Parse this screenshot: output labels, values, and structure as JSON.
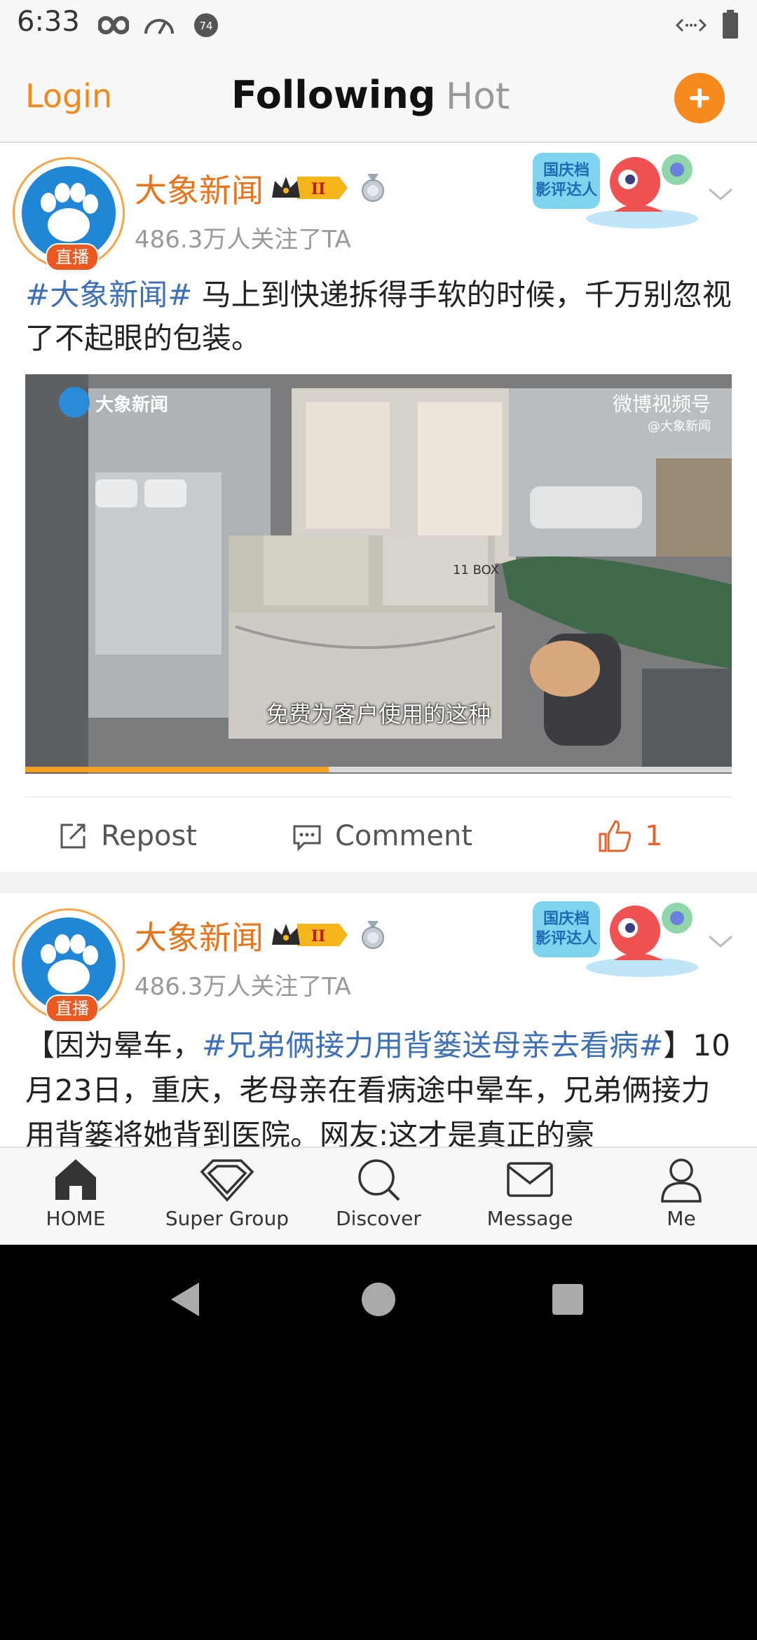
{
  "status_bar": {
    "time": "6:33",
    "badge_count": "74"
  },
  "top_nav": {
    "login": "Login",
    "tab_following": "Following",
    "tab_hot": "Hot"
  },
  "colors": {
    "accent": "#F68A1E",
    "hashtag": "#3D6FB6",
    "author": "#E8731B"
  },
  "posts": [
    {
      "author": "大象新闻",
      "followers": "486.3万人关注了TA",
      "live_badge": "直播",
      "level_badge": "II",
      "promo_text": "国庆档\n影评达人",
      "text_hashtag": "#大象新闻#",
      "text": " 马上到快递拆得手软的时候，千万别忽视了不起眼的包装。",
      "video": {
        "watermark_left": "大象新闻",
        "watermark_right": "微博视频号",
        "watermark_sub": "@大象新闻",
        "box_label": "11 BOX",
        "subtitle": "免费为客户使用的这种",
        "progress": 0.43
      },
      "actions": {
        "repost": "Repost",
        "comment": "Comment",
        "likes": "1"
      }
    },
    {
      "author": "大象新闻",
      "followers": "486.3万人关注了TA",
      "live_badge": "直播",
      "level_badge": "II",
      "promo_text": "国庆档\n影评达人",
      "text_pre": "【因为晕车，",
      "text_hashtag": "#兄弟俩接力用背篓送母亲去看病#",
      "text_post": "】10月23日，重庆，老母亲在看病途中晕车，兄弟俩接力用背篓将她背到医院。网友:这才是真正的豪"
    }
  ],
  "bottom_nav": {
    "items": [
      {
        "label": "HOME",
        "icon": "home-icon"
      },
      {
        "label": "Super Group",
        "icon": "diamond-icon"
      },
      {
        "label": "Discover",
        "icon": "search-icon"
      },
      {
        "label": "Message",
        "icon": "mail-icon"
      },
      {
        "label": "Me",
        "icon": "person-icon"
      }
    ]
  }
}
